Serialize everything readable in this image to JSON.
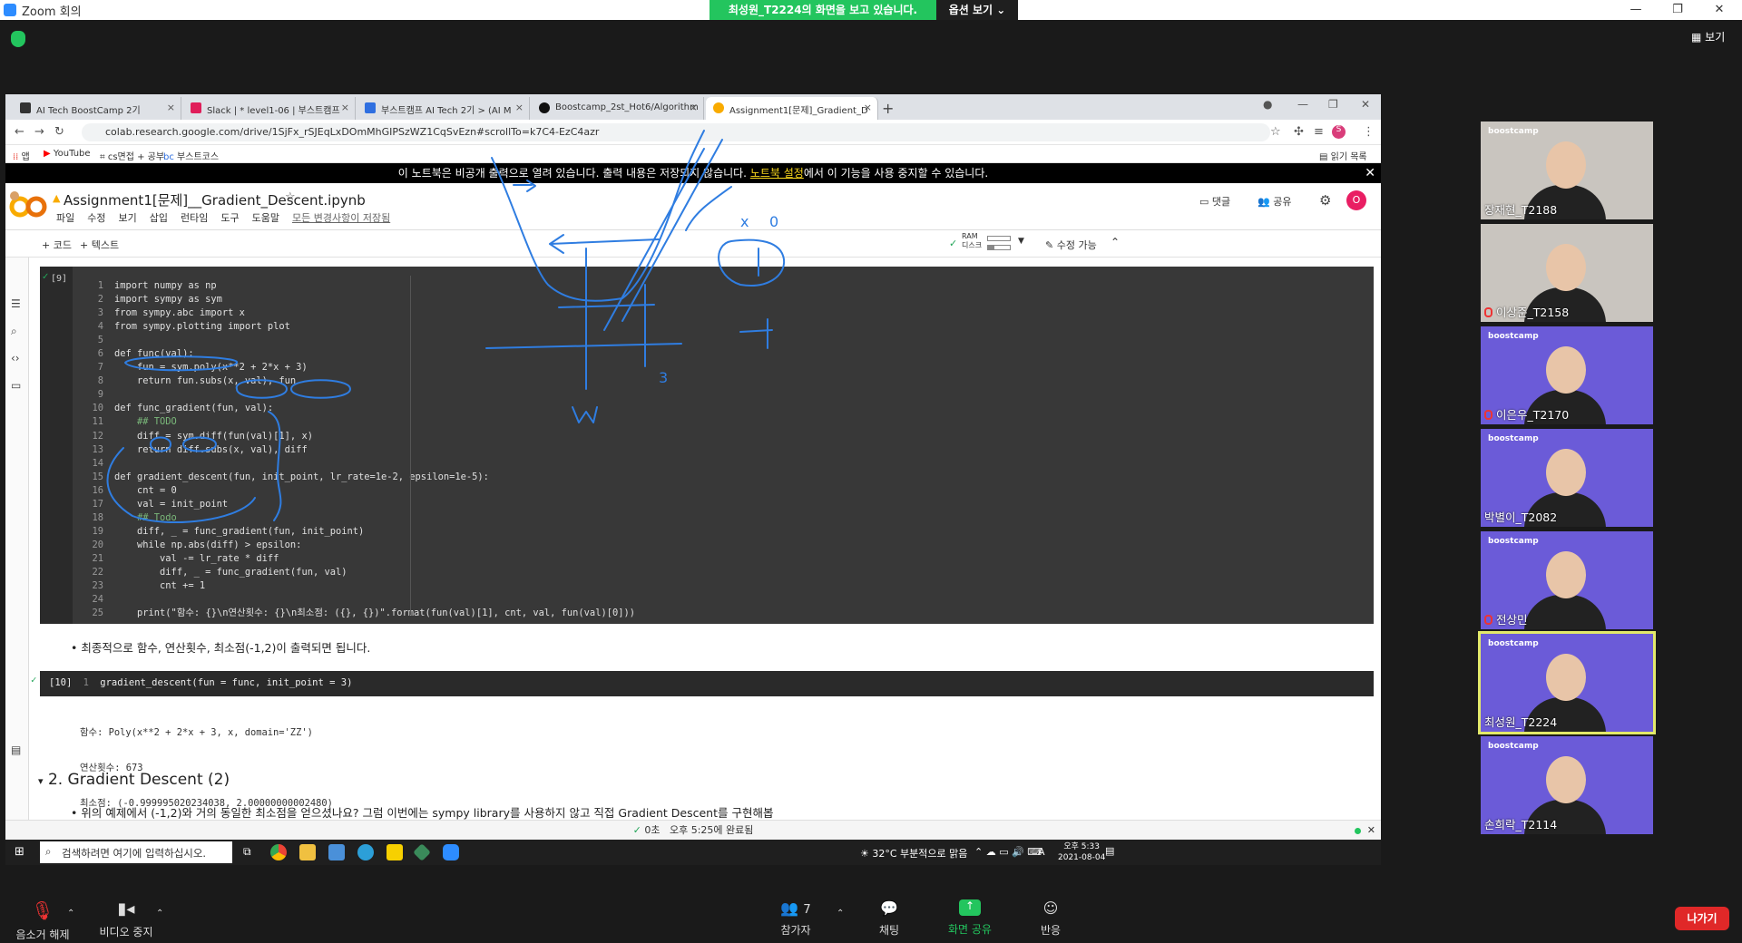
{
  "zoom": {
    "window_title": "Zoom 회의",
    "share_banner": "최성원_T2224의 화면을 보고 있습니다.",
    "options_label": "옵션 보기 ⌄",
    "view_label": "보기",
    "window_controls": [
      "—",
      "❐",
      "✕"
    ]
  },
  "browser": {
    "tabs": [
      {
        "label": "AI Tech BoostCamp 2기",
        "favicon_color": "#333333"
      },
      {
        "label": "Slack | * level1-06 | 부스트캠프",
        "favicon_color": "#e01e5a"
      },
      {
        "label": "부스트캠프 AI Tech 2기 > (AI M",
        "favicon_color": "#2f6fe0"
      },
      {
        "label": "Boostcamp_2st_Hot6/Algorithm",
        "favicon_color": "#111111"
      },
      {
        "label": "Assignment1[문제]_Gradient_D",
        "favicon_color": "#f9ab00"
      }
    ],
    "url": "colab.research.google.com/drive/1SjFx_rSJEqLxDOmMhGIPSzWZ1CqSvEzn#scrollTo=k7C4-EzC4azr",
    "bookmarks": [
      "앱",
      "YouTube",
      "cs면접 + 공부",
      "부스트코스"
    ],
    "reading_list": "읽기 목록"
  },
  "colab": {
    "notice_pre": "이 노트북은 비공개 출력으로 열려 있습니다. 출력 내용은 저장되지 않습니다. ",
    "notice_link": "노트북 설정",
    "notice_post": "에서 이 기능을 사용 중지할 수 있습니다.",
    "notebook_title": "Assignment1[문제]__Gradient_Descent.ipynb",
    "menus": [
      "파일",
      "수정",
      "보기",
      "삽입",
      "런타임",
      "도구",
      "도움말"
    ],
    "saved_status": "모든 변경사항이 저장됨",
    "comment_label": "댓글",
    "share_label": "공유",
    "avatar_letter": "O",
    "add_code": "+ 코드",
    "add_text": "+ 텍스트",
    "ram_label": "RAM",
    "disk_label": "디스크",
    "edit_mode": "수정 가능",
    "cell9_number": "[9]",
    "code_lines": [
      "import numpy as np",
      "import sympy as sym",
      "from sympy.abc import x",
      "from sympy.plotting import plot",
      "",
      "def func(val):",
      "    fun = sym.poly(x**2 + 2*x + 3)",
      "    return fun.subs(x, val), fun",
      "",
      "def func_gradient(fun, val):",
      "    ## TODO",
      "    diff = sym.diff(fun(val)[1], x)",
      "    return diff.subs(x, val), diff",
      "",
      "def gradient_descent(fun, init_point, lr_rate=1e-2, epsilon=1e-5):",
      "    cnt = 0",
      "    val = init_point",
      "    ## Todo",
      "    diff, _ = func_gradient(fun, init_point)",
      "    while np.abs(diff) > epsilon:",
      "        val -= lr_rate * diff",
      "        diff, _ = func_gradient(fun, val)",
      "        cnt += 1",
      "",
      "    print(\"함수: {}\\n연산횟수: {}\\n최소점: ({}, {})\".format(fun(val)[1], cnt, val, fun(val)[0]))"
    ],
    "bullet1": "최종적으로 함수, 연산횟수, 최소점(-1,2)이 출력되면 됩니다.",
    "cell10_number": "[10]",
    "cell10_code": "gradient_descent(fun = func, init_point = 3)",
    "output_lines": [
      "함수: Poly(x**2 + 2*x + 3, x, domain='ZZ')",
      "연산횟수: 673",
      "최소점: (-0.999995020234038, 2.00000000002480)"
    ],
    "section_title": "2. Gradient Descent (2)",
    "bullet2": "위의 예제에서 (-1,2)와 거의 동일한 최소점을 얻으셨나요? 그럼 이번에는 sympy library를 사용하지 않고 직접 Gradient Descent를 구현해봅",
    "status_check": "✓",
    "status_time": "0초",
    "status_done": "오후 5:25에 완료됨"
  },
  "taskbar": {
    "search_placeholder": "검색하려면 여기에 입력하십시오.",
    "weather": "32°C 부분적으로 맑음",
    "ime": "A",
    "time": "오후 5:33",
    "date": "2021-08-04"
  },
  "participants": [
    {
      "name": "장재현_T2188",
      "type": "real",
      "muted": false,
      "brand": "boostcamp"
    },
    {
      "name": "이상준_T2158",
      "type": "real",
      "muted": true,
      "brand": ""
    },
    {
      "name": "이은우_T2170",
      "type": "bg",
      "muted": true,
      "brand": "boostcamp"
    },
    {
      "name": "박별이_T2082",
      "type": "bg",
      "muted": false,
      "brand": "boostcamp"
    },
    {
      "name": "전상민",
      "type": "bg",
      "muted": true,
      "brand": "boostcamp"
    },
    {
      "name": "최성원_T2224",
      "type": "bg",
      "muted": false,
      "brand": "boostcamp",
      "active": true
    },
    {
      "name": "손희락_T2114",
      "type": "bg",
      "muted": false,
      "brand": "boostcamp"
    }
  ],
  "bottom_bar": {
    "unmute": "음소거 해제",
    "stop_video": "비디오 중지",
    "participants_label": "참가자",
    "participants_count": "7",
    "chat": "채팅",
    "share_screen": "화면 공유",
    "reactions": "반응",
    "leave": "나가기"
  },
  "colors": {
    "zoom_green": "#23c55e",
    "leave_red": "#e02828",
    "boostcamp_purple": "#6b5bd8",
    "ink_blue": "#2f7de1"
  }
}
